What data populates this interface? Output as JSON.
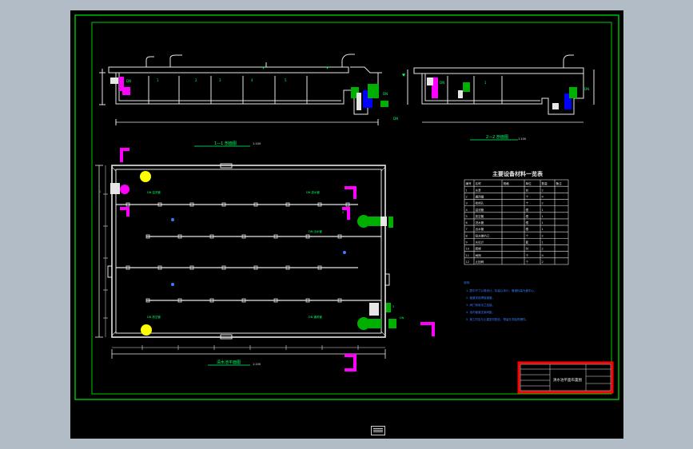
{
  "colors": {
    "background": "#b2bcc6",
    "viewport": "#000000",
    "frame": "#00c800",
    "linework": "#e6e6e6",
    "text_green": "#00ff66",
    "text_blue": "#3a7cff",
    "magenta": "#ff00ff",
    "yellow": "#ffff00",
    "title_block": "#ff0000",
    "equipment_blue": "#0000ff",
    "equipment_green": "#00b000"
  },
  "drawing": {
    "section_a": {
      "label": "1—1 剖面图",
      "scale": "1:100"
    },
    "section_b": {
      "label": "2—2 剖面图",
      "scale": "1:100"
    },
    "plan": {
      "label": "清水池平面图",
      "scale": "1:100"
    },
    "table": {
      "title": "主要设备材料一览表",
      "headers": [
        "编号",
        "名称",
        "规格",
        "单位",
        "数量",
        "备注"
      ],
      "rows": [
        [
          "1",
          "水泵",
          "",
          "台",
          "2",
          ""
        ],
        [
          "2",
          "通风帽",
          "",
          "个",
          "4",
          ""
        ],
        [
          "3",
          "检修孔",
          "",
          "个",
          "2",
          ""
        ],
        [
          "4",
          "溢流管",
          "",
          "根",
          "1",
          ""
        ],
        [
          "5",
          "放空管",
          "",
          "根",
          "1",
          ""
        ],
        [
          "6",
          "进水管",
          "",
          "根",
          "1",
          ""
        ],
        [
          "7",
          "出水管",
          "",
          "根",
          "1",
          ""
        ],
        [
          "8",
          "吸水喇叭口",
          "",
          "个",
          "2",
          ""
        ],
        [
          "9",
          "水位计",
          "",
          "套",
          "1",
          ""
        ],
        [
          "10",
          "爬梯",
          "",
          "付",
          "2",
          ""
        ],
        [
          "11",
          "闸阀",
          "",
          "个",
          "4",
          ""
        ],
        [
          "12",
          "止回阀",
          "",
          "个",
          "2",
          ""
        ]
      ]
    },
    "notes": {
      "heading": "说明:",
      "lines": [
        "1. 图中尺寸以毫米计，标高以米计，管道标高为管中心。",
        "2. 管道采用焊接钢管。",
        "3. 阀门采用法兰连接。",
        "4. 池内管道支架间距。",
        "5. 施工时应与土建密切配合，预留孔洞及预埋件。"
      ]
    },
    "title_block": {
      "name": "清水池平面布置图"
    }
  }
}
